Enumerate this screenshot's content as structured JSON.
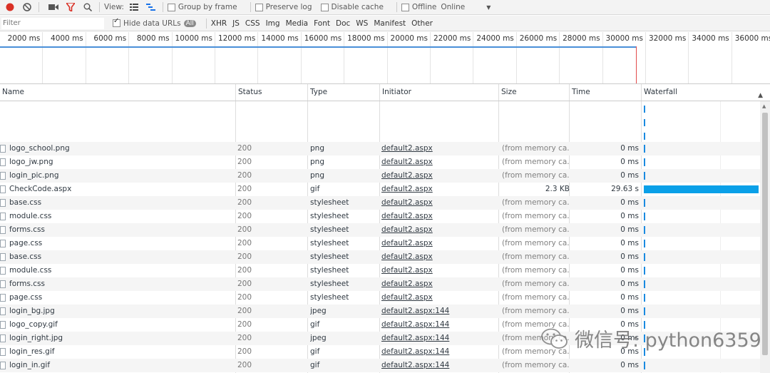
{
  "toolbar": {
    "view_label": "View:",
    "group_by_frame": "Group by frame",
    "preserve_log": "Preserve log",
    "disable_cache": "Disable cache",
    "offline": "Offline",
    "throttle": "Online",
    "colors": {
      "record": "#d93025",
      "filter": "#d93025"
    }
  },
  "filterbar": {
    "placeholder": "Filter",
    "hide_data_urls": "Hide data URLs",
    "types": [
      "All",
      "XHR",
      "JS",
      "CSS",
      "Img",
      "Media",
      "Font",
      "Doc",
      "WS",
      "Manifest",
      "Other"
    ]
  },
  "overview": {
    "ticks": [
      "2000 ms",
      "4000 ms",
      "6000 ms",
      "8000 ms",
      "10000 ms",
      "12000 ms",
      "14000 ms",
      "16000 ms",
      "18000 ms",
      "20000 ms",
      "22000 ms",
      "24000 ms",
      "26000 ms",
      "28000 ms",
      "30000 ms",
      "32000 ms",
      "34000 ms",
      "36000 ms"
    ]
  },
  "columns": {
    "name": "Name",
    "status": "Status",
    "type": "Type",
    "initiator": "Initiator",
    "size": "Size",
    "time": "Time",
    "waterfall": "Waterfall"
  },
  "rows": [
    {
      "name": "logo_school.png",
      "status": "200",
      "type": "png",
      "initiator": "default2.aspx",
      "size": "(from memory ca...",
      "time": "0 ms"
    },
    {
      "name": "logo_jw.png",
      "status": "200",
      "type": "png",
      "initiator": "default2.aspx",
      "size": "(from memory ca...",
      "time": "0 ms"
    },
    {
      "name": "login_pic.png",
      "status": "200",
      "type": "png",
      "initiator": "default2.aspx",
      "size": "(from memory ca...",
      "time": "0 ms"
    },
    {
      "name": "CheckCode.aspx",
      "status": "200",
      "type": "gif",
      "initiator": "default2.aspx",
      "size": "2.3 KB",
      "time": "29.63 s"
    },
    {
      "name": "base.css",
      "status": "200",
      "type": "stylesheet",
      "initiator": "default2.aspx",
      "size": "(from memory ca...",
      "time": "0 ms"
    },
    {
      "name": "module.css",
      "status": "200",
      "type": "stylesheet",
      "initiator": "default2.aspx",
      "size": "(from memory ca...",
      "time": "0 ms"
    },
    {
      "name": "forms.css",
      "status": "200",
      "type": "stylesheet",
      "initiator": "default2.aspx",
      "size": "(from memory ca...",
      "time": "0 ms"
    },
    {
      "name": "page.css",
      "status": "200",
      "type": "stylesheet",
      "initiator": "default2.aspx",
      "size": "(from memory ca...",
      "time": "0 ms"
    },
    {
      "name": "base.css",
      "status": "200",
      "type": "stylesheet",
      "initiator": "default2.aspx",
      "size": "(from memory ca...",
      "time": "0 ms"
    },
    {
      "name": "module.css",
      "status": "200",
      "type": "stylesheet",
      "initiator": "default2.aspx",
      "size": "(from memory ca...",
      "time": "0 ms"
    },
    {
      "name": "forms.css",
      "status": "200",
      "type": "stylesheet",
      "initiator": "default2.aspx",
      "size": "(from memory ca...",
      "time": "0 ms"
    },
    {
      "name": "page.css",
      "status": "200",
      "type": "stylesheet",
      "initiator": "default2.aspx",
      "size": "(from memory ca...",
      "time": "0 ms"
    },
    {
      "name": "login_bg.jpg",
      "status": "200",
      "type": "jpeg",
      "initiator": "default2.aspx:144",
      "size": "(from memory ca...",
      "time": "0 ms"
    },
    {
      "name": "logo_copy.gif",
      "status": "200",
      "type": "gif",
      "initiator": "default2.aspx:144",
      "size": "(from memory ca...",
      "time": "0 ms"
    },
    {
      "name": "login_right.jpg",
      "status": "200",
      "type": "jpeg",
      "initiator": "default2.aspx:144",
      "size": "(from memory ca...",
      "time": "0 ms"
    },
    {
      "name": "login_res.gif",
      "status": "200",
      "type": "gif",
      "initiator": "default2.aspx:144",
      "size": "(from memory ca...",
      "time": "0 ms"
    },
    {
      "name": "login_in.gif",
      "status": "200",
      "type": "gif",
      "initiator": "default2.aspx:144",
      "size": "(from memory ca...",
      "time": "0 ms"
    }
  ],
  "watermark": "微信号: python6359"
}
